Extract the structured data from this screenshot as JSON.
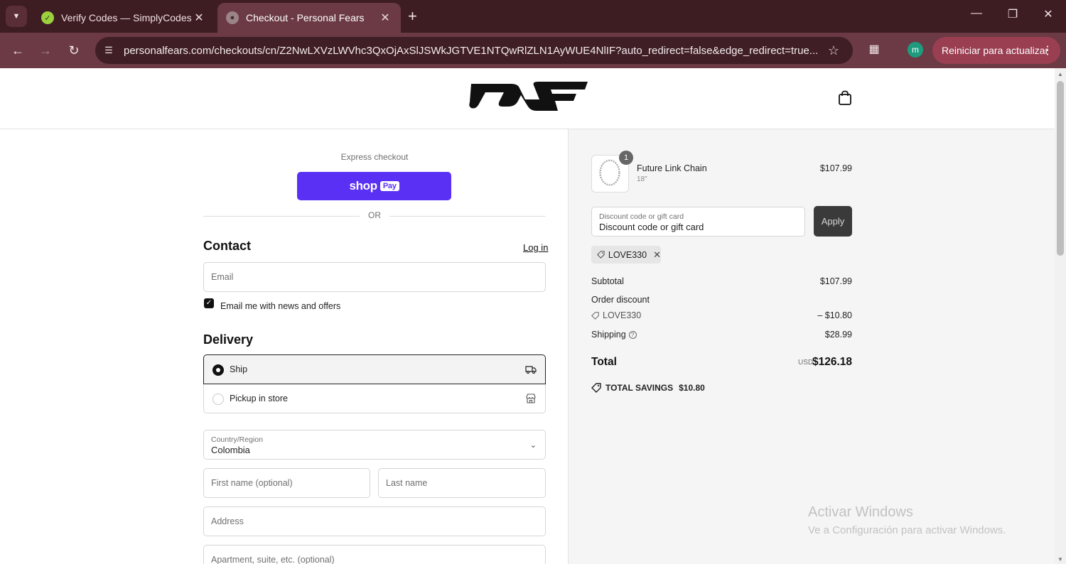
{
  "browser": {
    "tabs": [
      {
        "title": "Verify Codes — SimplyCodes",
        "active": false
      },
      {
        "title": "Checkout - Personal Fears",
        "active": true
      }
    ],
    "url": "personalfears.com/checkouts/cn/Z2NwLXVzLWVhc3QxOjAxSlJSWkJGTVE1NTQwRlZLN1AyWUE4NlIF?auto_redirect=false&edge_redirect=true...",
    "profile_initial": "m",
    "update_button": "Reiniciar para actualizar"
  },
  "checkout": {
    "express_label": "Express checkout",
    "shoppay_label": "shop",
    "shoppay_badge": "Pay",
    "or_label": "OR",
    "contact": {
      "title": "Contact",
      "login_link": "Log in",
      "email_placeholder": "Email",
      "newsletter_label": "Email me with news and offers",
      "newsletter_checked": true
    },
    "delivery": {
      "title": "Delivery",
      "options": [
        {
          "label": "Ship",
          "selected": true
        },
        {
          "label": "Pickup in store",
          "selected": false
        }
      ],
      "country_label": "Country/Region",
      "country_value": "Colombia",
      "first_name_placeholder": "First name (optional)",
      "last_name_placeholder": "Last name",
      "address_placeholder": "Address",
      "apartment_placeholder": "Apartment, suite, etc. (optional)"
    }
  },
  "summary": {
    "product": {
      "name": "Future Link Chain",
      "variant": "18\"",
      "price": "$107.99",
      "quantity": "1"
    },
    "discount_field": {
      "label": "Discount code or gift card",
      "placeholder": "Discount code or gift card"
    },
    "apply_label": "Apply",
    "applied_code": "LOVE330",
    "subtotal_label": "Subtotal",
    "subtotal_value": "$107.99",
    "order_discount_label": "Order discount",
    "discount_code": "LOVE330",
    "discount_value": "– $10.80",
    "shipping_label": "Shipping",
    "shipping_value": "$28.99",
    "total_label": "Total",
    "currency": "USD",
    "total_value": "$126.18",
    "savings_label": "TOTAL SAVINGS",
    "savings_value": "$10.80"
  },
  "watermark": {
    "title": "Activar Windows",
    "subtitle": "Ve a Configuración para activar Windows."
  },
  "colors": {
    "shoppay": "#5a31f4",
    "tabbar": "#3d1c22",
    "toolbar": "#6b3a44",
    "update_button": "#9a3f52"
  }
}
